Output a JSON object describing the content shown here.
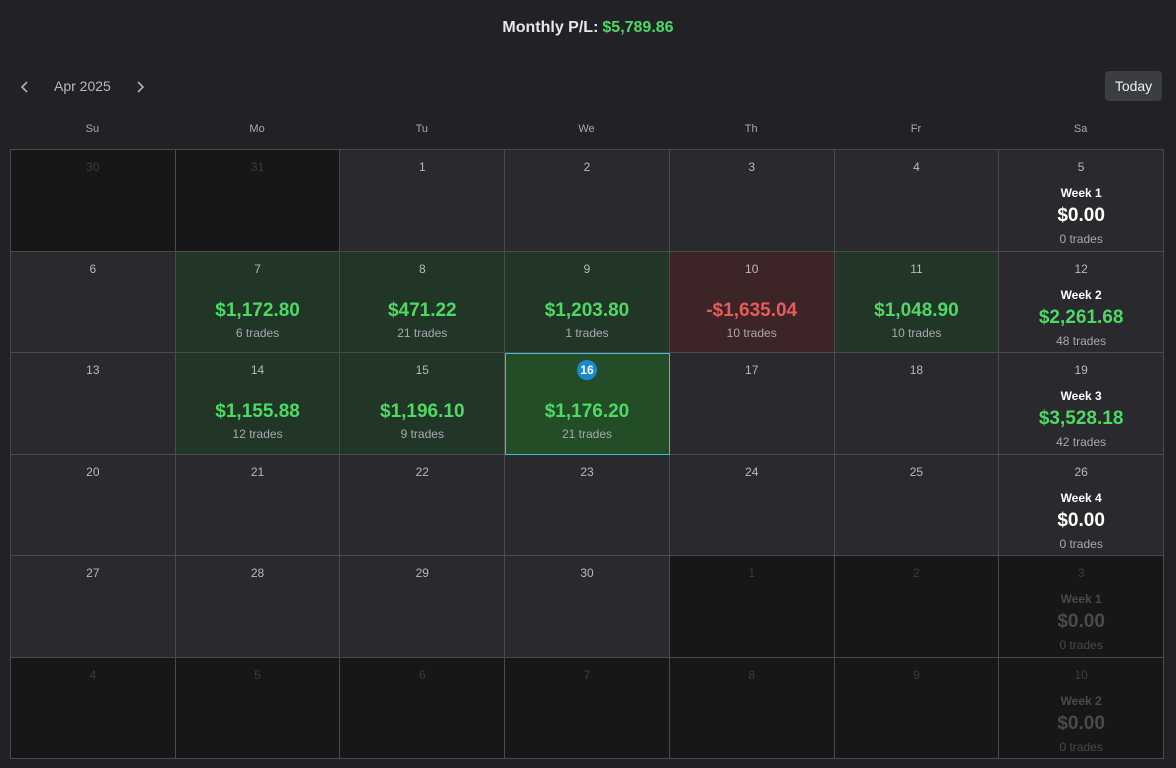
{
  "header": {
    "label": "Monthly P/L:",
    "value": "$5,789.86"
  },
  "toolbar": {
    "month": "Apr 2025",
    "today_label": "Today"
  },
  "weekdays": [
    "Su",
    "Mo",
    "Tu",
    "We",
    "Th",
    "Fr",
    "Sa"
  ],
  "colors": {
    "positive": "#4cd964",
    "negative": "#e85b5b",
    "today": "#1a8ad0"
  },
  "calendar": [
    [
      {
        "day": "30",
        "outside": true
      },
      {
        "day": "31",
        "outside": true
      },
      {
        "day": "1"
      },
      {
        "day": "2"
      },
      {
        "day": "3"
      },
      {
        "day": "4"
      },
      {
        "day": "5",
        "week": "Week 1",
        "week_amount": "$0.00",
        "week_trades": "0 trades",
        "week_tone": "neutral"
      }
    ],
    [
      {
        "day": "6"
      },
      {
        "day": "7",
        "amount": "$1,172.80",
        "trades": "6 trades",
        "tone": "pos"
      },
      {
        "day": "8",
        "amount": "$471.22",
        "trades": "21 trades",
        "tone": "pos"
      },
      {
        "day": "9",
        "amount": "$1,203.80",
        "trades": "1 trades",
        "tone": "pos"
      },
      {
        "day": "10",
        "amount": "-$1,635.04",
        "trades": "10 trades",
        "tone": "neg"
      },
      {
        "day": "11",
        "amount": "$1,048.90",
        "trades": "10 trades",
        "tone": "pos"
      },
      {
        "day": "12",
        "week": "Week 2",
        "week_amount": "$2,261.68",
        "week_trades": "48 trades",
        "week_tone": "pos"
      }
    ],
    [
      {
        "day": "13"
      },
      {
        "day": "14",
        "amount": "$1,155.88",
        "trades": "12 trades",
        "tone": "pos"
      },
      {
        "day": "15",
        "amount": "$1,196.10",
        "trades": "9 trades",
        "tone": "pos"
      },
      {
        "day": "16",
        "amount": "$1,176.20",
        "trades": "21 trades",
        "tone": "pos",
        "today": true
      },
      {
        "day": "17"
      },
      {
        "day": "18"
      },
      {
        "day": "19",
        "week": "Week 3",
        "week_amount": "$3,528.18",
        "week_trades": "42 trades",
        "week_tone": "pos"
      }
    ],
    [
      {
        "day": "20"
      },
      {
        "day": "21"
      },
      {
        "day": "22"
      },
      {
        "day": "23"
      },
      {
        "day": "24"
      },
      {
        "day": "25"
      },
      {
        "day": "26",
        "week": "Week 4",
        "week_amount": "$0.00",
        "week_trades": "0 trades",
        "week_tone": "neutral"
      }
    ],
    [
      {
        "day": "27"
      },
      {
        "day": "28"
      },
      {
        "day": "29"
      },
      {
        "day": "30"
      },
      {
        "day": "1",
        "outside": true
      },
      {
        "day": "2",
        "outside": true
      },
      {
        "day": "3",
        "outside": true,
        "week": "Week 1",
        "week_amount": "$0.00",
        "week_trades": "0 trades",
        "week_tone": "neutral"
      }
    ],
    [
      {
        "day": "4",
        "outside": true
      },
      {
        "day": "5",
        "outside": true
      },
      {
        "day": "6",
        "outside": true
      },
      {
        "day": "7",
        "outside": true
      },
      {
        "day": "8",
        "outside": true
      },
      {
        "day": "9",
        "outside": true
      },
      {
        "day": "10",
        "outside": true,
        "week": "Week 2",
        "week_amount": "$0.00",
        "week_trades": "0 trades",
        "week_tone": "neutral"
      }
    ]
  ]
}
